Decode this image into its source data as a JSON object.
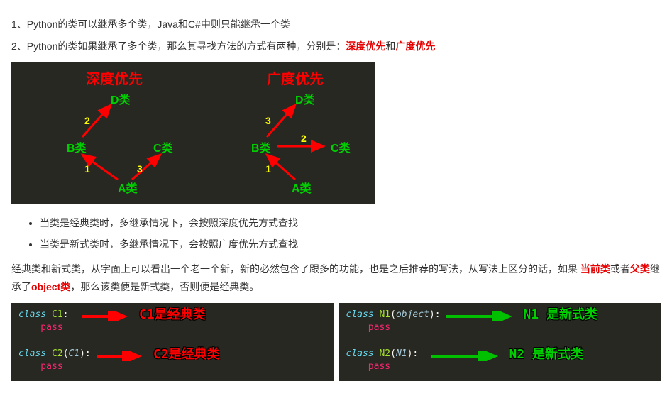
{
  "para1": "1、Python的类可以继承多个类，Java和C#中则只能继承一个类",
  "para2_prefix": "2、Python的类如果继承了多个类，那么其寻找方法的方式有两种，分别是：",
  "para2_hl1": "深度优先",
  "para2_and": "和",
  "para2_hl2": "广度优先",
  "diagram": {
    "title_left": "深度优先",
    "title_right": "广度优先",
    "nodeA": "A类",
    "nodeB": "B类",
    "nodeC": "C类",
    "nodeD": "D类",
    "n1": "1",
    "n2": "2",
    "n3": "3"
  },
  "bullets": [
    "当类是经典类时，多继承情况下，会按照深度优先方式查找",
    "当类是新式类时，多继承情况下，会按照广度优先方式查找"
  ],
  "para3_1": "经典类和新式类，从字面上可以看出一个老一个新，新的必然包含了跟多的功能，也是之后推荐的写法，从写法上区分的话，如果 ",
  "para3_hl1": "当前类",
  "para3_2": "或者",
  "para3_hl2": "父类",
  "para3_3": "继承了",
  "para3_hl3": "object类",
  "para3_4": "，那么该类便是新式类，否则便是经典类。",
  "code_left": {
    "c1_line1_kw": "class",
    "c1_line1_name": " C1",
    "c1_line1_colon": ":",
    "c1_line2": "    pass",
    "c2_line1_kw": "class",
    "c2_line1_name": " C2",
    "c2_line1_paren": "(",
    "c2_line1_arg": "C1",
    "c2_line1_close": "):",
    "c2_line2": "    pass",
    "label1": "C1是经典类",
    "label2": "C2是经典类"
  },
  "code_right": {
    "n1_line1_kw": "class",
    "n1_line1_name": " N1",
    "n1_line1_paren": "(",
    "n1_line1_arg": "object",
    "n1_line1_close": "):",
    "n1_line2": "    pass",
    "n2_line1_kw": "class",
    "n2_line1_name": " N2",
    "n2_line1_paren": "(",
    "n2_line1_arg": "N1",
    "n2_line1_close": "):",
    "n2_line2": "    pass",
    "label1": "N1 是新式类",
    "label2": "N2 是新式类"
  }
}
